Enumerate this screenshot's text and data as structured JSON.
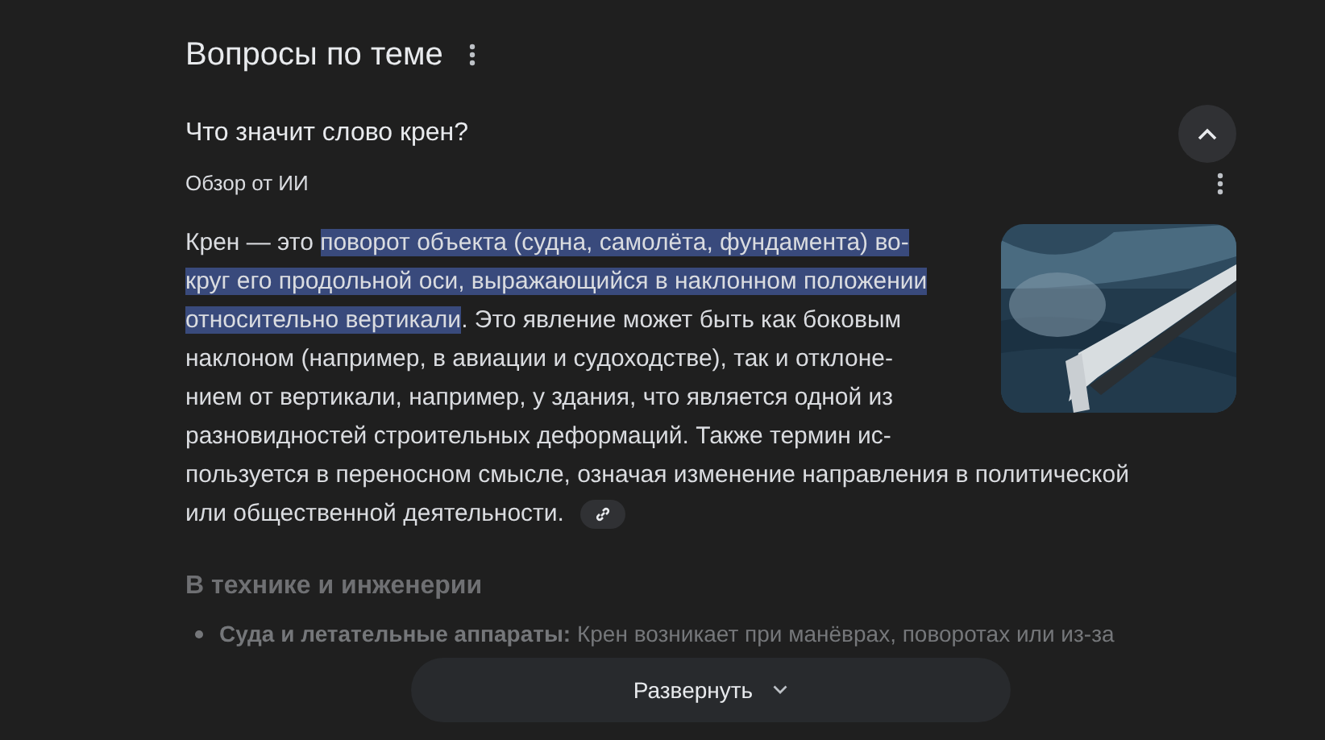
{
  "section": {
    "title": "Вопросы по теме"
  },
  "question": {
    "text": "Что значит слово крен?",
    "expanded": true
  },
  "overview": {
    "label": "Обзор от ИИ"
  },
  "answer": {
    "image": {
      "kind": "picture"
    },
    "lines": [
      [
        {
          "text": "Крен — это ",
          "highlighted": false
        },
        {
          "text": "поворот объекта (судна, самолёта, фундамента) во-",
          "highlighted": true
        }
      ],
      [
        {
          "text": "круг его продольной оси, выражающийся в наклонном положении",
          "highlighted": true
        }
      ],
      [
        {
          "text": "относительно вертикали",
          "highlighted": true
        },
        {
          "text": ". Это явление может быть как боковым",
          "highlighted": false
        }
      ],
      [
        {
          "text": "наклоном (например, в авиации и судоходстве), так и отклоне-",
          "highlighted": false
        }
      ],
      [
        {
          "text": "нием от вертикали, например, у здания, что является одной из",
          "highlighted": false
        }
      ],
      [
        {
          "text": "разновидностей строительных деформаций. Также термин ис-",
          "highlighted": false
        }
      ],
      [
        {
          "text": "пользуется в переносном смысле, означая изменение направления в политической",
          "highlighted": false
        }
      ],
      [
        {
          "text": "или общественной деятельности.",
          "highlighted": false
        }
      ]
    ]
  },
  "subsection": {
    "title": "В технике и инженерии",
    "bullets": [
      "**Суда и летательные аппараты:** Крен возникает при манёврах, поворотах или из-за"
    ]
  },
  "expand_button": {
    "label": "Развернуть"
  }
}
